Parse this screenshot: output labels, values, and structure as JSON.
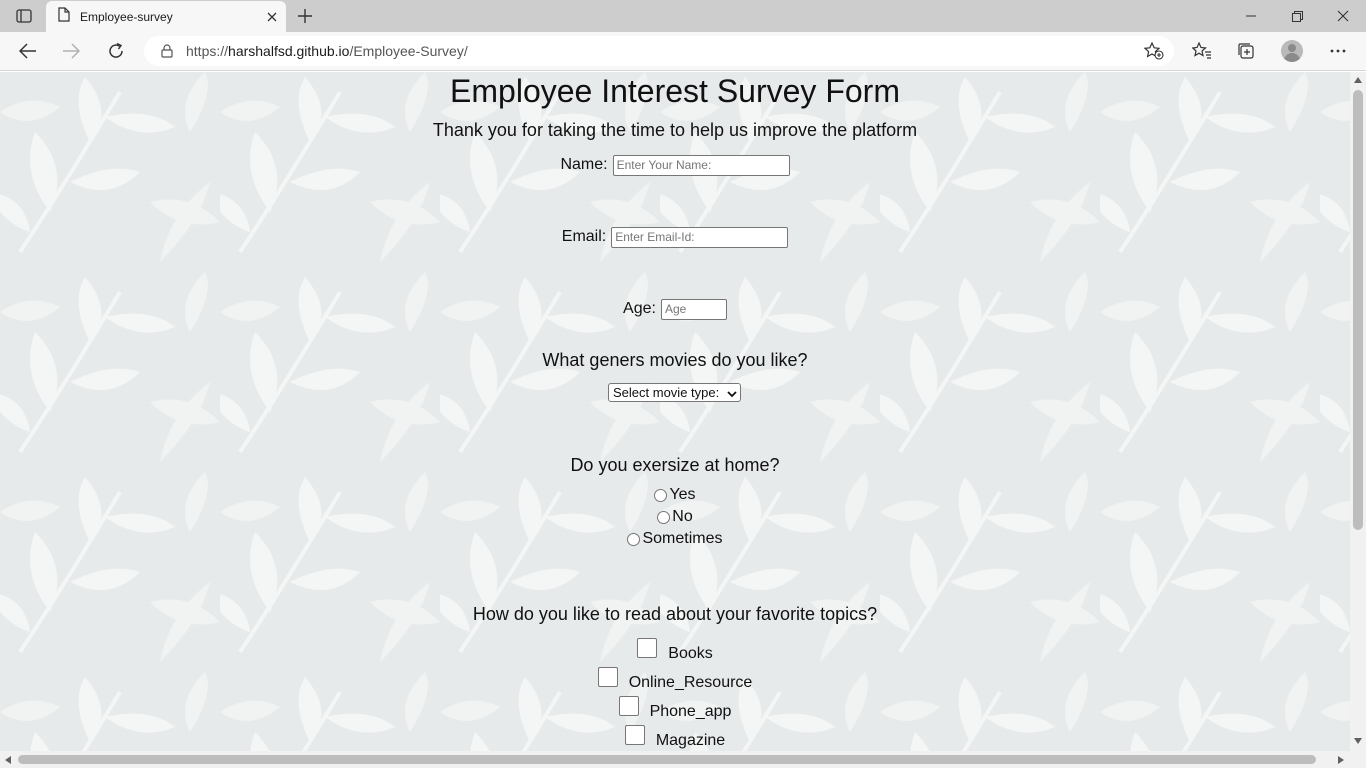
{
  "browser": {
    "tab_title": "Employee-survey",
    "url_prefix": "https://",
    "url_host": "harshalfsd.github.io",
    "url_path": "/Employee-Survey/"
  },
  "page": {
    "title": "Employee Interest Survey Form",
    "subtitle": "Thank you for taking the time to help us improve the platform",
    "name": {
      "label": "Name:",
      "placeholder": "Enter Your Name:"
    },
    "email": {
      "label": "Email:",
      "placeholder": "Enter Email-Id:"
    },
    "age": {
      "label": "Age:",
      "placeholder": "Age"
    },
    "movies": {
      "question": "What geners movies do you like?",
      "selected": "Select movie type:"
    },
    "exercise": {
      "question": "Do you exersize at home?",
      "options": [
        "Yes",
        "No",
        "Sometimes"
      ]
    },
    "topics": {
      "question": "How do you like to read about your favorite topics?",
      "options": [
        "Books",
        "Online_Resource",
        "Phone_app",
        "Magazine"
      ]
    }
  },
  "colors": {
    "background": "#e7eaeb",
    "leaf": "#f5f7f7",
    "text": "#111111"
  }
}
